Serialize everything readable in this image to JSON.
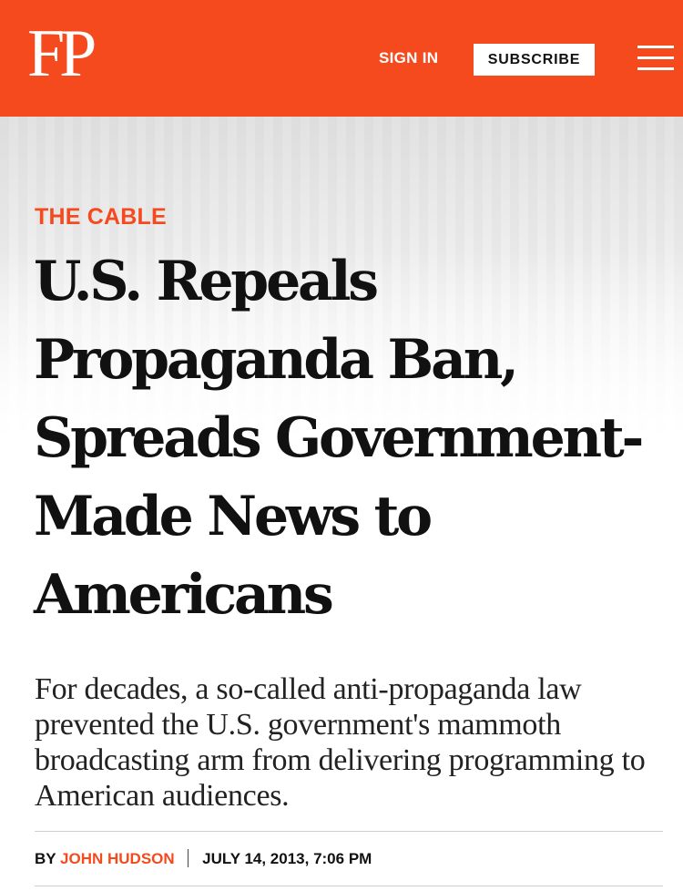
{
  "header": {
    "logo_text": "FP",
    "sign_in_label": "SIGN IN",
    "subscribe_label": "SUBSCRIBE",
    "menu_icon": "hamburger-menu-icon",
    "brand_color": "#f54a1d"
  },
  "article": {
    "kicker": "THE CABLE",
    "headline": "U.S. Repeals Propaganda Ban, Spreads Government-Made News to Americans",
    "dek": "For decades, a so-called anti-propaganda law prevented the U.S. government's mammoth broadcasting arm from delivering programming to American audiences.",
    "byline": {
      "prefix": "BY",
      "author": "JOHN HUDSON",
      "date": "JULY 14, 2013, 7:06 PM"
    }
  }
}
